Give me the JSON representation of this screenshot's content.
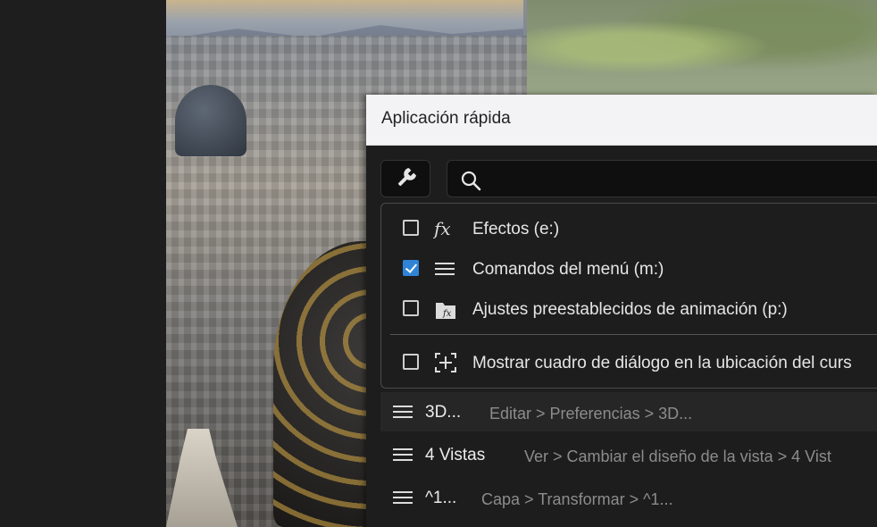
{
  "dialog": {
    "title": "Aplicación rápida",
    "tool_icon": "wrench-icon",
    "search": {
      "placeholder": "",
      "value": "",
      "icon": "search-icon"
    }
  },
  "filters": [
    {
      "label": "Efectos (e:)",
      "checked": false,
      "icon": "fx-icon"
    },
    {
      "label": "Comandos del menú (m:)",
      "checked": true,
      "icon": "menu-lines-icon"
    },
    {
      "label": "Ajustes preestablecidos de animación (p:)",
      "checked": false,
      "icon": "animation-preset-icon"
    },
    {
      "label": "Mostrar cuadro de diálogo en la ubicación del curs",
      "checked": false,
      "icon": "cursor-location-icon"
    }
  ],
  "results": [
    {
      "name": "3D...",
      "path": "Editar > Preferencias > 3D...",
      "icon": "menu-lines-icon"
    },
    {
      "name": "4 Vistas",
      "path": "Ver > Cambiar el diseño de la vista > 4 Vist",
      "icon": "menu-lines-icon"
    },
    {
      "name": "^1...",
      "path": "Capa > Transformar > ^1...",
      "icon": "menu-lines-icon"
    }
  ],
  "colors": {
    "accent": "#2f84d7",
    "panel": "#1d1d1d",
    "titlebar": "#f3f2f4"
  }
}
